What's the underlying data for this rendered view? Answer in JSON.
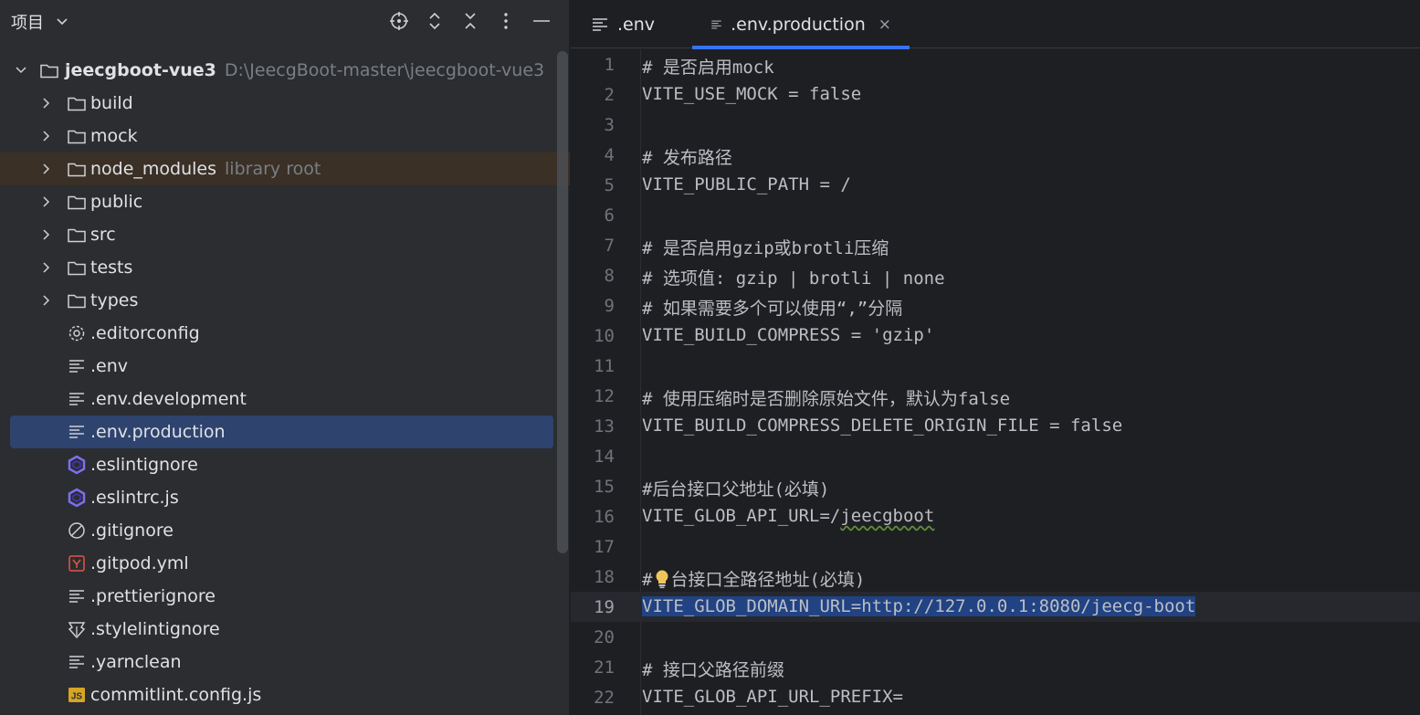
{
  "panel": {
    "title": "项目"
  },
  "tree": {
    "root": {
      "name": "jeecgboot-vue3",
      "path": "D:\\JeecgBoot-master\\jeecgboot-vue3"
    },
    "items": [
      {
        "name": "build",
        "kind": "folder"
      },
      {
        "name": "mock",
        "kind": "folder"
      },
      {
        "name": "node_modules",
        "kind": "folder",
        "hint": "library root"
      },
      {
        "name": "public",
        "kind": "folder"
      },
      {
        "name": "src",
        "kind": "folder"
      },
      {
        "name": "tests",
        "kind": "folder"
      },
      {
        "name": "types",
        "kind": "folder"
      },
      {
        "name": ".editorconfig",
        "kind": "gear-file"
      },
      {
        "name": ".env",
        "kind": "text-file"
      },
      {
        "name": ".env.development",
        "kind": "text-file"
      },
      {
        "name": ".env.production",
        "kind": "text-file"
      },
      {
        "name": ".eslintignore",
        "kind": "eslint-file"
      },
      {
        "name": ".eslintrc.js",
        "kind": "eslint-file"
      },
      {
        "name": ".gitignore",
        "kind": "ignore-file"
      },
      {
        "name": ".gitpod.yml",
        "kind": "yaml-file"
      },
      {
        "name": ".prettierignore",
        "kind": "text-file"
      },
      {
        "name": ".stylelintignore",
        "kind": "stylelint-file"
      },
      {
        "name": ".yarnclean",
        "kind": "text-file"
      },
      {
        "name": "commitlint.config.js",
        "kind": "js-file"
      }
    ]
  },
  "editor": {
    "tabs": [
      {
        "label": ".env"
      },
      {
        "label": ".env.production"
      }
    ],
    "close_glyph": "×",
    "lines": [
      {
        "n": "1",
        "text": "# 是否启用mock"
      },
      {
        "n": "2",
        "text": "VITE_USE_MOCK = false"
      },
      {
        "n": "3",
        "text": ""
      },
      {
        "n": "4",
        "text": "# 发布路径"
      },
      {
        "n": "5",
        "text": "VITE_PUBLIC_PATH = /"
      },
      {
        "n": "6",
        "text": ""
      },
      {
        "n": "7",
        "text": "# 是否启用gzip或brotli压缩"
      },
      {
        "n": "8",
        "text": "# 选项值: gzip | brotli | none"
      },
      {
        "n": "9",
        "text": "# 如果需要多个可以使用“,”分隔"
      },
      {
        "n": "10",
        "text": "VITE_BUILD_COMPRESS = 'gzip'"
      },
      {
        "n": "11",
        "text": ""
      },
      {
        "n": "12",
        "text": "# 使用压缩时是否删除原始文件，默认为false"
      },
      {
        "n": "13",
        "text": "VITE_BUILD_COMPRESS_DELETE_ORIGIN_FILE = false"
      },
      {
        "n": "14",
        "text": ""
      },
      {
        "n": "15",
        "text": "#后台接口父地址(必填)"
      },
      {
        "n": "16",
        "text_prefix": "VITE_GLOB_API_URL=/",
        "text_squiggle": "jeecgboot"
      },
      {
        "n": "17",
        "text": ""
      },
      {
        "n": "18",
        "text_prefix": "#",
        "text_after_bulb": "台接口全路径地址(必填)"
      },
      {
        "n": "19",
        "text": "VITE_GLOB_DOMAIN_URL=http://127.0.0.1:8080/jeecg-boot"
      },
      {
        "n": "20",
        "text": ""
      },
      {
        "n": "21",
        "text": "# 接口父路径前缀"
      },
      {
        "n": "22",
        "text": "VITE_GLOB_API_URL_PREFIX="
      }
    ]
  }
}
